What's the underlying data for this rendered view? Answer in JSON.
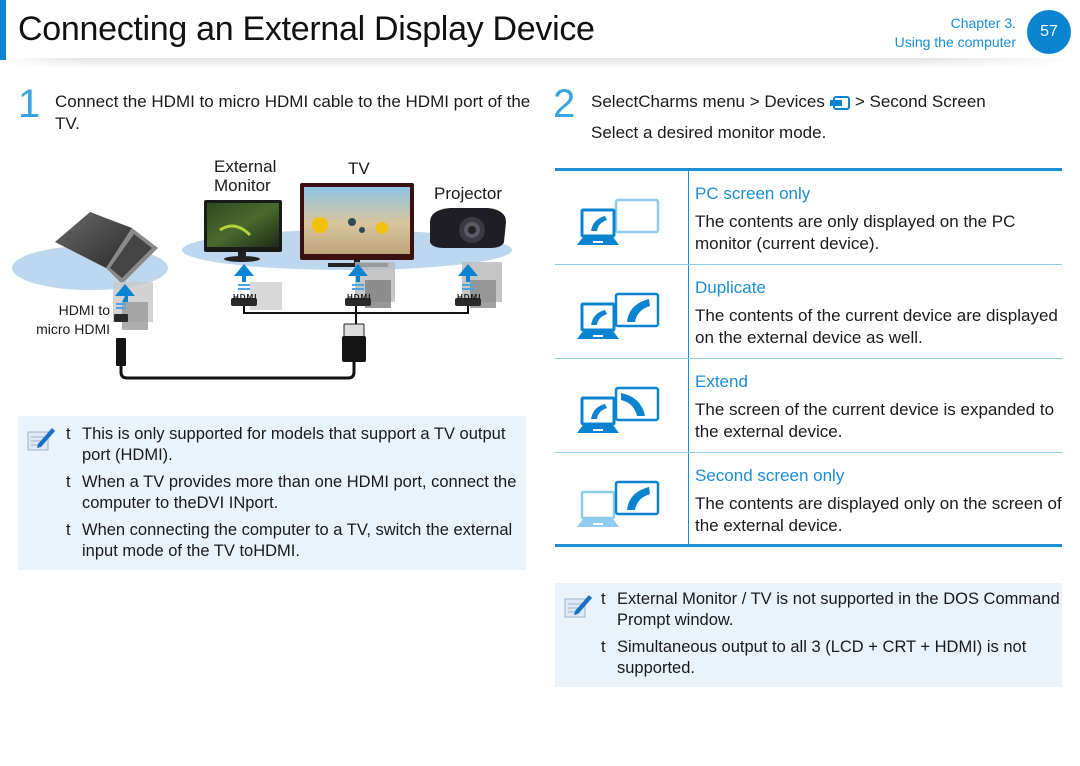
{
  "header": {
    "title": "Connecting an External Display Device",
    "chapter_line1": "Chapter 3.",
    "chapter_line2": "Using the computer",
    "page_number": "57",
    "accent_color": "#0a84d0"
  },
  "step1": {
    "number": "1",
    "text": "Connect the HDMI to micro HDMI cable to the HDMI port of the TV."
  },
  "diagram": {
    "labels": {
      "external_monitor_line1": "External",
      "external_monitor_line2": "Monitor",
      "tv": "TV",
      "projector": "Projector",
      "cable_line1": "HDMI to",
      "cable_line2": "micro HDMI"
    },
    "port_labels": [
      "HDMI",
      "HDMI",
      "HDMI"
    ]
  },
  "note_left": {
    "icon": "note-pencil-icon",
    "bullet": "t",
    "items": [
      "This is only supported for models that support a TV output port (HDMI).",
      "When a TV provides more than one HDMI port, connect the computer to theDVI INport.",
      "When connecting the computer to a TV, switch the external input mode of the TV toHDMI."
    ]
  },
  "step2": {
    "number": "2",
    "text_before_icon": "SelectCharms menu > Devices",
    "icon": "devices-icon",
    "text_after_icon": "> Second Screen",
    "subtext": "Select a desired monitor mode."
  },
  "modes": [
    {
      "icon": "pc-screen-only-icon",
      "title": "PC screen only",
      "description": "The contents are only displayed on the PC monitor (current device)."
    },
    {
      "icon": "duplicate-icon",
      "title": "Duplicate",
      "description": "The contents of the current device are displayed on the external device as well."
    },
    {
      "icon": "extend-icon",
      "title": "Extend",
      "description": "The screen of the current device is expanded to the external device."
    },
    {
      "icon": "second-screen-only-icon",
      "title": "Second screen only",
      "description": "The contents are displayed only on the screen of the external device."
    }
  ],
  "note_right": {
    "icon": "note-pencil-icon",
    "bullet": "t",
    "items": [
      "External Monitor / TV is not supported in the DOS Command Prompt window.",
      "Simultaneous output to all 3 (LCD + CRT + HDMI) is not supported."
    ]
  },
  "colors": {
    "accent": "#1a8fd6",
    "light_accent": "#8fcbec",
    "note_bg": "#eaf2fa"
  }
}
